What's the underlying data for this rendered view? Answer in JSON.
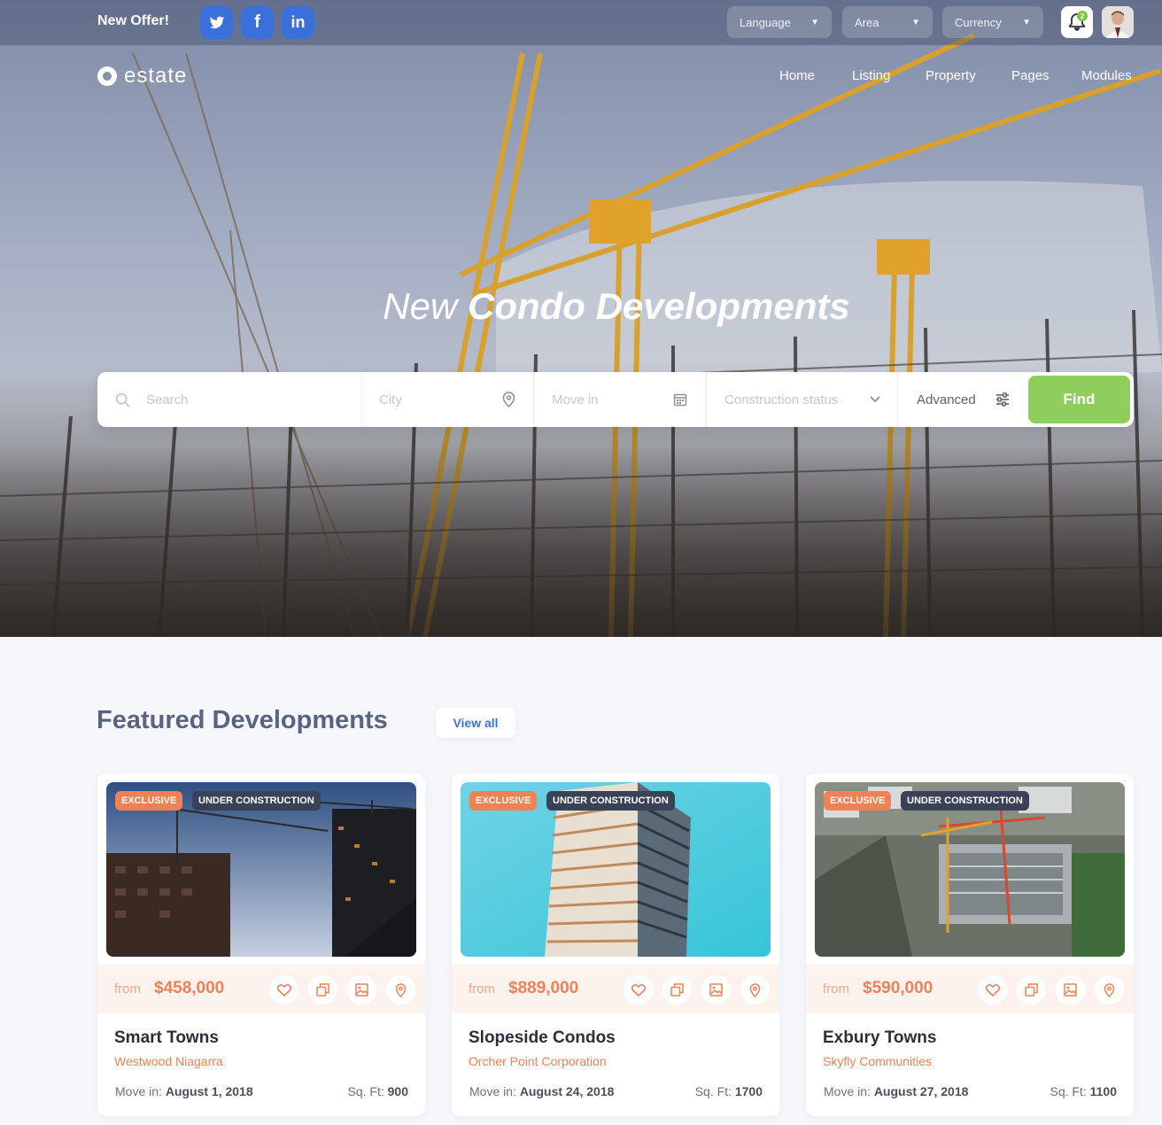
{
  "topbar": {
    "offer_label": "New Offer!",
    "social": [
      {
        "icon": "twitter-icon",
        "glyph": "t"
      },
      {
        "icon": "facebook-icon",
        "glyph": "f"
      },
      {
        "icon": "linkedin-icon",
        "glyph": "in"
      }
    ],
    "dropdowns": {
      "language": "Language",
      "area": "Area",
      "currency": "Currency"
    },
    "notifications_count": "2"
  },
  "brand": {
    "name": "estate"
  },
  "nav": {
    "items": [
      "Home",
      "Listing",
      "Property",
      "Pages",
      "Modules"
    ]
  },
  "hero": {
    "title_light": "New",
    "title_bold": "Condo Developments"
  },
  "search": {
    "search_placeholder": "Search",
    "city_placeholder": "City",
    "movein_placeholder": "Move in",
    "status_placeholder": "Construction status",
    "advanced_label": "Advanced",
    "find_label": "Find"
  },
  "featured": {
    "title": "Featured Developments",
    "view_all_label": "View all",
    "tag_exclusive": "EXCLUSIVE",
    "tag_status": "UNDER CONSTRUCTION",
    "from_label": "from",
    "movein_label": "Move in:",
    "sqft_label": "Sq. Ft:",
    "cards": [
      {
        "name": "Smart Towns",
        "company": "Westwood Niagarra",
        "price": "$458,000",
        "move_in": "August 1, 2018",
        "sqft": "900"
      },
      {
        "name": "Slopeside Condos",
        "company": "Orcher Point Corporation",
        "price": "$889,000",
        "move_in": "August 24, 2018",
        "sqft": "1700"
      },
      {
        "name": "Exbury Towns",
        "company": "Skyfly Communities",
        "price": "$590,000",
        "move_in": "August 27, 2018",
        "sqft": "1100"
      }
    ]
  },
  "colors": {
    "accent_green": "#8fce5d",
    "accent_orange": "#ef8154",
    "link_blue": "#3d73d6",
    "social_blue": "#3b6fd9"
  }
}
